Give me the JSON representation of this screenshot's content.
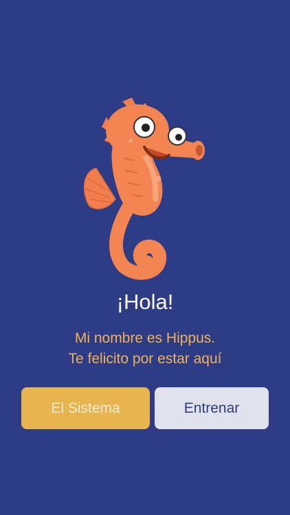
{
  "screen": {
    "background": "#2e3b85"
  },
  "mascot": {
    "icon": "seahorse-mascot-icon",
    "color": "#f28552"
  },
  "greeting": {
    "title": "¡Hola!",
    "line1": "Mi nombre es Hippus.",
    "line2": "Te felicito por estar aquí"
  },
  "buttons": {
    "system_label": "El Sistema",
    "system_color": "#e8b44e",
    "train_label": "Entrenar",
    "train_color": "#e1e2ed"
  }
}
